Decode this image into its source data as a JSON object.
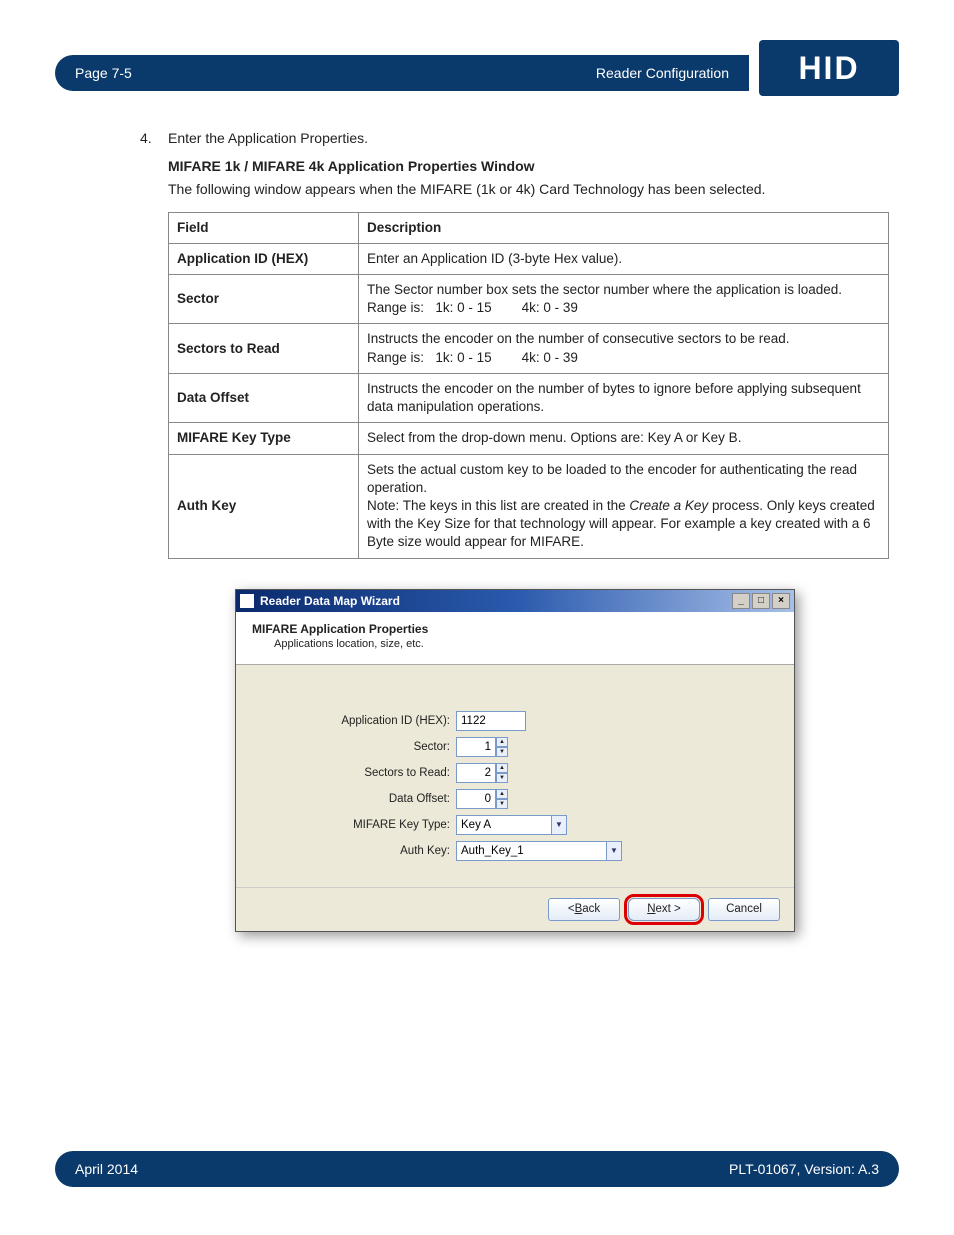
{
  "header": {
    "page": "Page 7-5",
    "section": "Reader Configuration",
    "logo": "HID"
  },
  "step": {
    "num": "4.",
    "text": "Enter the Application Properties."
  },
  "subhead": "MIFARE 1k / MIFARE 4k Application Properties Window",
  "intro": "The following window appears when the MIFARE (1k or 4k) Card Technology has been selected.",
  "table": {
    "h1": "Field",
    "h2": "Description",
    "rows": [
      {
        "field": "Application ID (HEX)",
        "desc": "Enter an Application ID (3-byte Hex value)."
      },
      {
        "field": "Sector",
        "desc_line1": "The Sector number box sets the sector number where the application is loaded.",
        "range_label": "Range is:",
        "range_a": "1k: 0 - 15",
        "range_b": "4k: 0 - 39"
      },
      {
        "field": "Sectors to Read",
        "desc_line1": "Instructs the encoder on the number of consecutive sectors to be read.",
        "range_label": "Range is:",
        "range_a": "1k: 0 - 15",
        "range_b": "4k: 0 - 39"
      },
      {
        "field": "Data Offset",
        "desc": "Instructs the encoder on the number of bytes to ignore before applying subsequent data manipulation operations."
      },
      {
        "field": "MIFARE Key Type",
        "desc": "Select from the drop-down menu. Options are: Key A or Key B."
      },
      {
        "field": "Auth Key",
        "desc_line1": "Sets the actual custom key to be loaded to the encoder for authenticating the read operation.",
        "note_prefix": "Note: The keys in this list are created in the ",
        "note_em": "Create a Key",
        "note_suffix": " process. Only keys created with the Key Size for that technology will appear. For example a key created with a 6 Byte size would appear for MIFARE."
      }
    ]
  },
  "wizard": {
    "title": "Reader Data Map Wizard",
    "h1": "MIFARE Application Properties",
    "h2": "Applications location, size, etc.",
    "fields": {
      "app_id_label": "Application ID (HEX):",
      "app_id_value": "1122",
      "sector_label": "Sector:",
      "sector_value": "1",
      "sectors_read_label": "Sectors to Read:",
      "sectors_read_value": "2",
      "data_offset_label": "Data Offset:",
      "data_offset_value": "0",
      "key_type_label": "MIFARE Key Type:",
      "key_type_value": "Key A",
      "auth_key_label": "Auth Key:",
      "auth_key_value": "Auth_Key_1"
    },
    "buttons": {
      "back_prefix": "< ",
      "back_u": "B",
      "back_rest": "ack",
      "next_u": "N",
      "next_rest": "ext >",
      "cancel": "Cancel"
    }
  },
  "footer": {
    "date": "April 2014",
    "doc": "PLT-01067, Version: A.3"
  }
}
